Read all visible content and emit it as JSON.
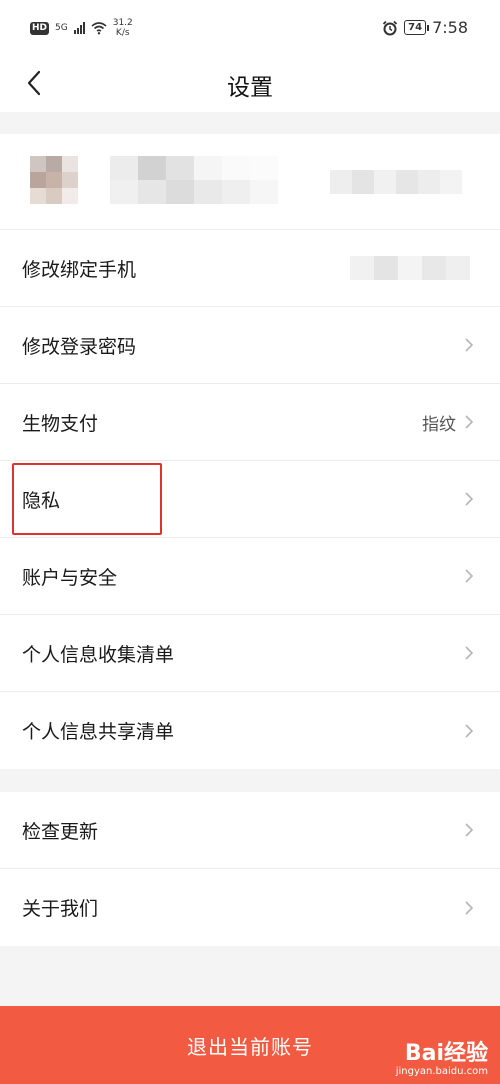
{
  "status_bar": {
    "hd": "HD",
    "network": "5G",
    "speed_value": "31.2",
    "speed_unit": "K/s",
    "battery": "74",
    "time": "7:58"
  },
  "nav": {
    "title": "设置"
  },
  "section1": {
    "items": [
      {
        "label": "修改绑定手机"
      },
      {
        "label": "修改登录密码"
      },
      {
        "label": "生物支付",
        "value": "指纹"
      },
      {
        "label": "隐私"
      },
      {
        "label": "账户与安全"
      },
      {
        "label": "个人信息收集清单"
      },
      {
        "label": "个人信息共享清单"
      }
    ]
  },
  "section2": {
    "items": [
      {
        "label": "检查更新"
      },
      {
        "label": "关于我们"
      }
    ]
  },
  "logout": {
    "label": "退出当前账号"
  },
  "watermark": {
    "brand": "Bai经验",
    "url": "jingyan.baidu.com"
  },
  "colors": {
    "accent": "#f35a42",
    "highlight": "#e0332e"
  },
  "icons": {
    "back": "back-arrow-icon",
    "chevron": "chevron-right-icon"
  }
}
